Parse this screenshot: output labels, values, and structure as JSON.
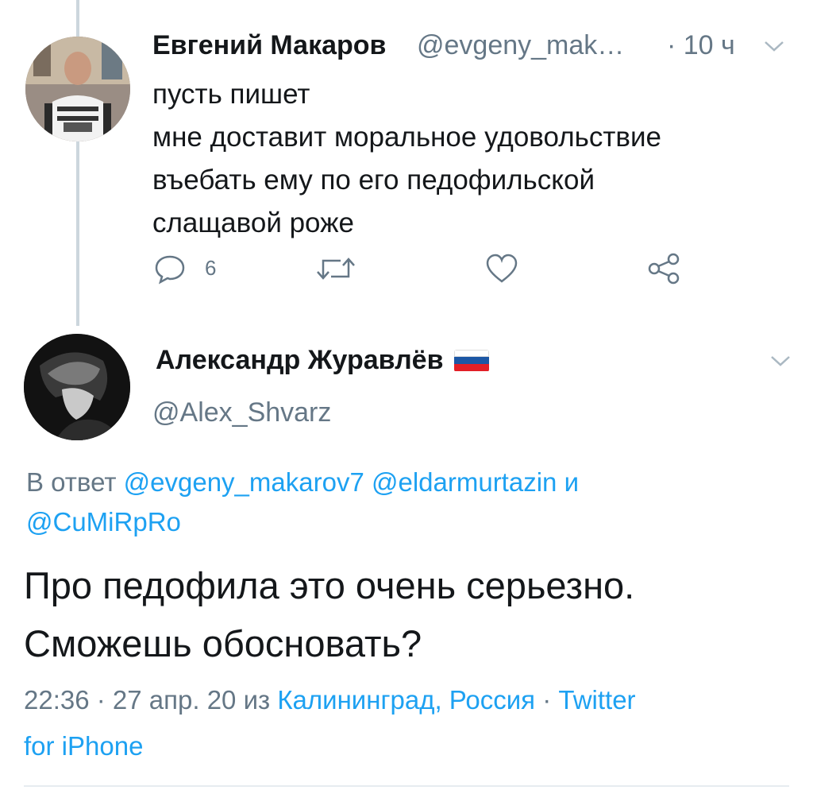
{
  "tweet1": {
    "author_name": "Евгений Макаров",
    "handle": "@evgeny_mak…",
    "time": "· 10 ч",
    "lines": [
      "пусть пишет",
      "мне доставит моральное удовольствие",
      "въебать ему по его педофильской",
      "слащавой роже"
    ],
    "reply_count": "6"
  },
  "tweet2": {
    "author_name": "Александр Журавлёв",
    "handle": "@Alex_Shvarz",
    "reply_prefix": "В ответ",
    "reply_user1": "@evgeny_makarov7",
    "reply_user2": "@eldarmurtazin",
    "reply_and": "и",
    "reply_user3": "@CuMiRpRo",
    "text_lines": [
      "Про педофила это очень серьезно.",
      "Сможешь обосновать?"
    ],
    "timestamp": "22:36 · 27 апр. 20 из",
    "location": "Калининград, Россия",
    "dot": "·",
    "source_line1": "Twitter",
    "source_line2": "for iPhone"
  },
  "colors": {
    "link": "#1da1f2",
    "secondary_text": "#657786",
    "primary_text": "#14171a",
    "thread_line": "#ccd6dd"
  },
  "icons": {
    "reply": "reply-icon",
    "retweet": "retweet-icon",
    "like": "heart-icon",
    "share": "share-icon",
    "chevron": "chevron-down-icon",
    "flag": "russia-flag-icon"
  }
}
